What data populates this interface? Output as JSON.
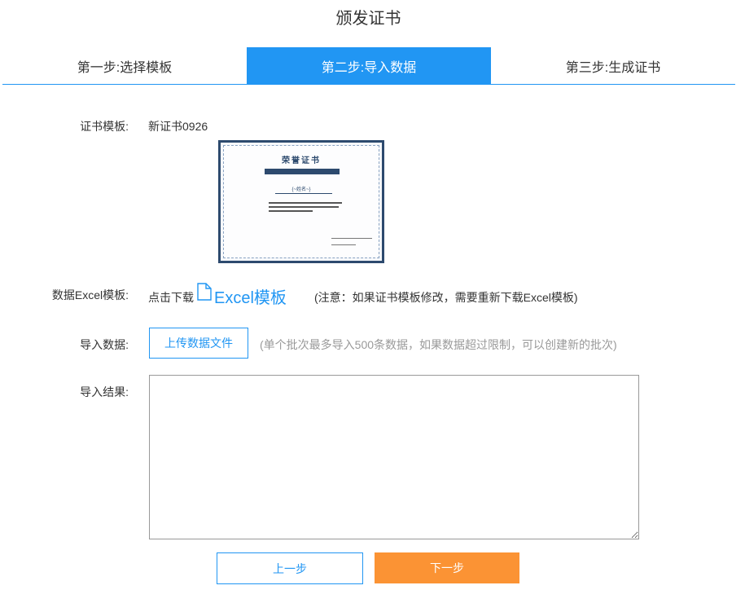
{
  "page": {
    "title": "颁发证书"
  },
  "steps": [
    {
      "label": "第一步:选择模板",
      "active": false
    },
    {
      "label": "第二步:导入数据",
      "active": true
    },
    {
      "label": "第三步:生成证书",
      "active": false
    }
  ],
  "template_row": {
    "label": "证书模板:",
    "name": "新证书0926",
    "preview": {
      "title": "荣誉证书",
      "name_placeholder": "{~姓名~}"
    }
  },
  "excel_row": {
    "label": "数据Excel模板:",
    "prefix": "点击下载",
    "link": "Excel模板",
    "note": "(注意：如果证书模板修改，需要重新下载Excel模板)"
  },
  "import_row": {
    "label": "导入数据:",
    "button": "上传数据文件",
    "hint": "(单个批次最多导入500条数据，如果数据超过限制，可以创建新的批次)"
  },
  "result_row": {
    "label": "导入结果:",
    "value": ""
  },
  "footer": {
    "prev": "上一步",
    "next": "下一步"
  },
  "colors": {
    "primary": "#2196f3",
    "accent": "#fb9334",
    "cert_border": "#2d4a6e"
  }
}
